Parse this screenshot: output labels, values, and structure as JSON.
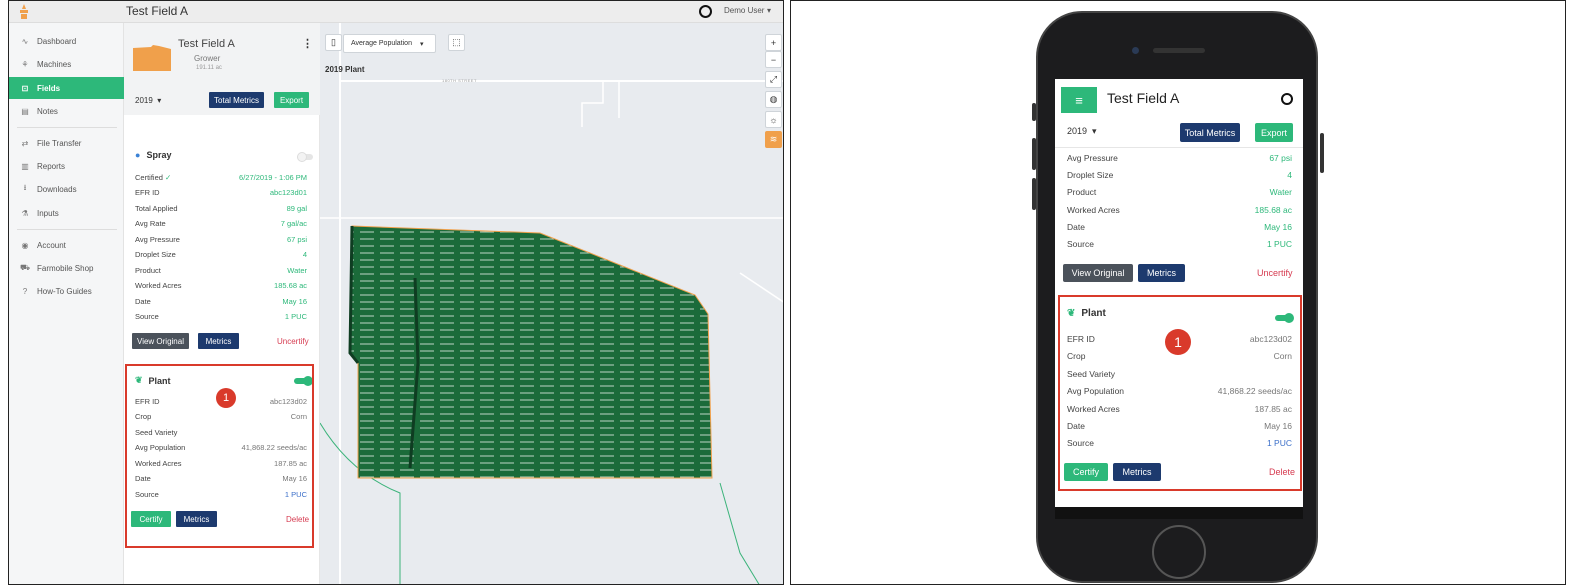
{
  "desktop": {
    "window_title": "Test Field A",
    "user_name": "Demo User",
    "nav": [
      {
        "icon": "∿",
        "icon_name": "dashboard-icon",
        "label": "Dashboard"
      },
      {
        "icon": "⚘",
        "icon_name": "machines-icon",
        "label": "Machines"
      },
      {
        "icon": "⊡",
        "icon_name": "fields-icon",
        "label": "Fields",
        "active": true
      },
      {
        "icon": "▤",
        "icon_name": "notes-icon",
        "label": "Notes"
      },
      {
        "icon": "⇄",
        "icon_name": "file-transfer-icon",
        "label": "File Transfer"
      },
      {
        "icon": "▥",
        "icon_name": "reports-icon",
        "label": "Reports"
      },
      {
        "icon": "⭳",
        "icon_name": "downloads-icon",
        "label": "Downloads"
      },
      {
        "icon": "⚗",
        "icon_name": "inputs-icon",
        "label": "Inputs"
      },
      {
        "icon": "◉",
        "icon_name": "account-icon",
        "label": "Account"
      },
      {
        "icon": "⛟",
        "icon_name": "shop-icon",
        "label": "Farmobile Shop"
      },
      {
        "icon": "?",
        "icon_name": "help-icon",
        "label": "How-To Guides"
      }
    ],
    "field": {
      "name": "Test Field A",
      "grower": "Grower",
      "acres": "191.11 ac"
    },
    "year": "2019",
    "total_metrics_label": "Total Metrics",
    "export_label": "Export",
    "spray": {
      "title": "Spray",
      "certified_label": "Certified",
      "certified_value": "6/27/2019 - 1:06 PM",
      "rows": [
        {
          "k": "EFR ID",
          "v": "abc123d01"
        },
        {
          "k": "Total Applied",
          "v": "89 gal"
        },
        {
          "k": "Avg Rate",
          "v": "7 gal/ac"
        },
        {
          "k": "Avg Pressure",
          "v": "67 psi"
        },
        {
          "k": "Droplet Size",
          "v": "4"
        },
        {
          "k": "Product",
          "v": "Water"
        },
        {
          "k": "Worked Acres",
          "v": "185.68 ac"
        },
        {
          "k": "Date",
          "v": "May 16"
        },
        {
          "k": "Source",
          "v": "1 PUC"
        }
      ],
      "view_original_label": "View Original",
      "metrics_label": "Metrics",
      "uncertify_label": "Uncertify"
    },
    "plant": {
      "title": "Plant",
      "rows": [
        {
          "k": "EFR ID",
          "v": "abc123d02"
        },
        {
          "k": "Crop",
          "v": "Corn"
        },
        {
          "k": "Seed Variety",
          "v": ""
        },
        {
          "k": "Avg Population",
          "v": "41,868.22 seeds/ac"
        },
        {
          "k": "Worked Acres",
          "v": "187.85 ac"
        },
        {
          "k": "Date",
          "v": "May 16"
        },
        {
          "k": "Source",
          "v": "1 PUC"
        }
      ],
      "certify_label": "Certify",
      "metrics_label": "Metrics",
      "delete_label": "Delete"
    },
    "map": {
      "layer_select": "Average Population",
      "layer_title": "2019 Plant",
      "street_label": "180TH STREET",
      "zoom_in": "+",
      "zoom_out": "−"
    },
    "callout": "1"
  },
  "mobile": {
    "title": "Test Field A",
    "year": "2019",
    "total_metrics_label": "Total Metrics",
    "export_label": "Export",
    "spray_rows": [
      {
        "k": "Avg Pressure",
        "v": "67 psi"
      },
      {
        "k": "Droplet Size",
        "v": "4"
      },
      {
        "k": "Product",
        "v": "Water"
      },
      {
        "k": "Worked Acres",
        "v": "185.68 ac"
      },
      {
        "k": "Date",
        "v": "May 16"
      },
      {
        "k": "Source",
        "v": "1 PUC"
      }
    ],
    "view_original_label": "View Original",
    "metrics_label": "Metrics",
    "uncertify_label": "Uncertify",
    "plant": {
      "title": "Plant",
      "rows": [
        {
          "k": "EFR ID",
          "v": "abc123d02"
        },
        {
          "k": "Crop",
          "v": "Corn"
        },
        {
          "k": "Seed Variety",
          "v": ""
        },
        {
          "k": "Avg Population",
          "v": "41,868.22 seeds/ac"
        },
        {
          "k": "Worked Acres",
          "v": "187.85 ac"
        },
        {
          "k": "Date",
          "v": "May 16"
        },
        {
          "k": "Source",
          "v": "1 PUC"
        }
      ],
      "certify_label": "Certify",
      "metrics_label": "Metrics",
      "delete_label": "Delete"
    },
    "callout": "1"
  },
  "colors": {
    "brand_green": "#2db87a",
    "navy": "#1d3a6e",
    "danger_red": "#d63b50",
    "highlight_red": "#d93a2b",
    "field_orange": "#f0a04b",
    "crop_green": "#1b6b3a"
  }
}
